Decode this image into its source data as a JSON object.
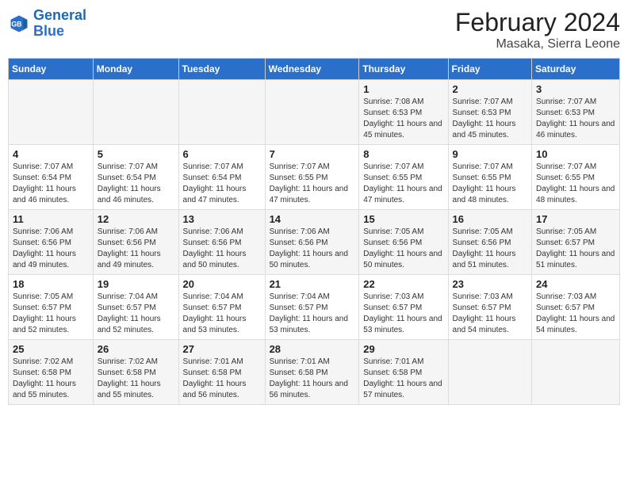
{
  "logo": {
    "line1": "General",
    "line2": "Blue"
  },
  "title": "February 2024",
  "subtitle": "Masaka, Sierra Leone",
  "days_of_week": [
    "Sunday",
    "Monday",
    "Tuesday",
    "Wednesday",
    "Thursday",
    "Friday",
    "Saturday"
  ],
  "weeks": [
    [
      {
        "day": "",
        "sunrise": "",
        "sunset": "",
        "daylight": ""
      },
      {
        "day": "",
        "sunrise": "",
        "sunset": "",
        "daylight": ""
      },
      {
        "day": "",
        "sunrise": "",
        "sunset": "",
        "daylight": ""
      },
      {
        "day": "",
        "sunrise": "",
        "sunset": "",
        "daylight": ""
      },
      {
        "day": "1",
        "sunrise": "Sunrise: 7:08 AM",
        "sunset": "Sunset: 6:53 PM",
        "daylight": "Daylight: 11 hours and 45 minutes."
      },
      {
        "day": "2",
        "sunrise": "Sunrise: 7:07 AM",
        "sunset": "Sunset: 6:53 PM",
        "daylight": "Daylight: 11 hours and 45 minutes."
      },
      {
        "day": "3",
        "sunrise": "Sunrise: 7:07 AM",
        "sunset": "Sunset: 6:53 PM",
        "daylight": "Daylight: 11 hours and 46 minutes."
      }
    ],
    [
      {
        "day": "4",
        "sunrise": "Sunrise: 7:07 AM",
        "sunset": "Sunset: 6:54 PM",
        "daylight": "Daylight: 11 hours and 46 minutes."
      },
      {
        "day": "5",
        "sunrise": "Sunrise: 7:07 AM",
        "sunset": "Sunset: 6:54 PM",
        "daylight": "Daylight: 11 hours and 46 minutes."
      },
      {
        "day": "6",
        "sunrise": "Sunrise: 7:07 AM",
        "sunset": "Sunset: 6:54 PM",
        "daylight": "Daylight: 11 hours and 47 minutes."
      },
      {
        "day": "7",
        "sunrise": "Sunrise: 7:07 AM",
        "sunset": "Sunset: 6:55 PM",
        "daylight": "Daylight: 11 hours and 47 minutes."
      },
      {
        "day": "8",
        "sunrise": "Sunrise: 7:07 AM",
        "sunset": "Sunset: 6:55 PM",
        "daylight": "Daylight: 11 hours and 47 minutes."
      },
      {
        "day": "9",
        "sunrise": "Sunrise: 7:07 AM",
        "sunset": "Sunset: 6:55 PM",
        "daylight": "Daylight: 11 hours and 48 minutes."
      },
      {
        "day": "10",
        "sunrise": "Sunrise: 7:07 AM",
        "sunset": "Sunset: 6:55 PM",
        "daylight": "Daylight: 11 hours and 48 minutes."
      }
    ],
    [
      {
        "day": "11",
        "sunrise": "Sunrise: 7:06 AM",
        "sunset": "Sunset: 6:56 PM",
        "daylight": "Daylight: 11 hours and 49 minutes."
      },
      {
        "day": "12",
        "sunrise": "Sunrise: 7:06 AM",
        "sunset": "Sunset: 6:56 PM",
        "daylight": "Daylight: 11 hours and 49 minutes."
      },
      {
        "day": "13",
        "sunrise": "Sunrise: 7:06 AM",
        "sunset": "Sunset: 6:56 PM",
        "daylight": "Daylight: 11 hours and 50 minutes."
      },
      {
        "day": "14",
        "sunrise": "Sunrise: 7:06 AM",
        "sunset": "Sunset: 6:56 PM",
        "daylight": "Daylight: 11 hours and 50 minutes."
      },
      {
        "day": "15",
        "sunrise": "Sunrise: 7:05 AM",
        "sunset": "Sunset: 6:56 PM",
        "daylight": "Daylight: 11 hours and 50 minutes."
      },
      {
        "day": "16",
        "sunrise": "Sunrise: 7:05 AM",
        "sunset": "Sunset: 6:56 PM",
        "daylight": "Daylight: 11 hours and 51 minutes."
      },
      {
        "day": "17",
        "sunrise": "Sunrise: 7:05 AM",
        "sunset": "Sunset: 6:57 PM",
        "daylight": "Daylight: 11 hours and 51 minutes."
      }
    ],
    [
      {
        "day": "18",
        "sunrise": "Sunrise: 7:05 AM",
        "sunset": "Sunset: 6:57 PM",
        "daylight": "Daylight: 11 hours and 52 minutes."
      },
      {
        "day": "19",
        "sunrise": "Sunrise: 7:04 AM",
        "sunset": "Sunset: 6:57 PM",
        "daylight": "Daylight: 11 hours and 52 minutes."
      },
      {
        "day": "20",
        "sunrise": "Sunrise: 7:04 AM",
        "sunset": "Sunset: 6:57 PM",
        "daylight": "Daylight: 11 hours and 53 minutes."
      },
      {
        "day": "21",
        "sunrise": "Sunrise: 7:04 AM",
        "sunset": "Sunset: 6:57 PM",
        "daylight": "Daylight: 11 hours and 53 minutes."
      },
      {
        "day": "22",
        "sunrise": "Sunrise: 7:03 AM",
        "sunset": "Sunset: 6:57 PM",
        "daylight": "Daylight: 11 hours and 53 minutes."
      },
      {
        "day": "23",
        "sunrise": "Sunrise: 7:03 AM",
        "sunset": "Sunset: 6:57 PM",
        "daylight": "Daylight: 11 hours and 54 minutes."
      },
      {
        "day": "24",
        "sunrise": "Sunrise: 7:03 AM",
        "sunset": "Sunset: 6:57 PM",
        "daylight": "Daylight: 11 hours and 54 minutes."
      }
    ],
    [
      {
        "day": "25",
        "sunrise": "Sunrise: 7:02 AM",
        "sunset": "Sunset: 6:58 PM",
        "daylight": "Daylight: 11 hours and 55 minutes."
      },
      {
        "day": "26",
        "sunrise": "Sunrise: 7:02 AM",
        "sunset": "Sunset: 6:58 PM",
        "daylight": "Daylight: 11 hours and 55 minutes."
      },
      {
        "day": "27",
        "sunrise": "Sunrise: 7:01 AM",
        "sunset": "Sunset: 6:58 PM",
        "daylight": "Daylight: 11 hours and 56 minutes."
      },
      {
        "day": "28",
        "sunrise": "Sunrise: 7:01 AM",
        "sunset": "Sunset: 6:58 PM",
        "daylight": "Daylight: 11 hours and 56 minutes."
      },
      {
        "day": "29",
        "sunrise": "Sunrise: 7:01 AM",
        "sunset": "Sunset: 6:58 PM",
        "daylight": "Daylight: 11 hours and 57 minutes."
      },
      {
        "day": "",
        "sunrise": "",
        "sunset": "",
        "daylight": ""
      },
      {
        "day": "",
        "sunrise": "",
        "sunset": "",
        "daylight": ""
      }
    ]
  ]
}
